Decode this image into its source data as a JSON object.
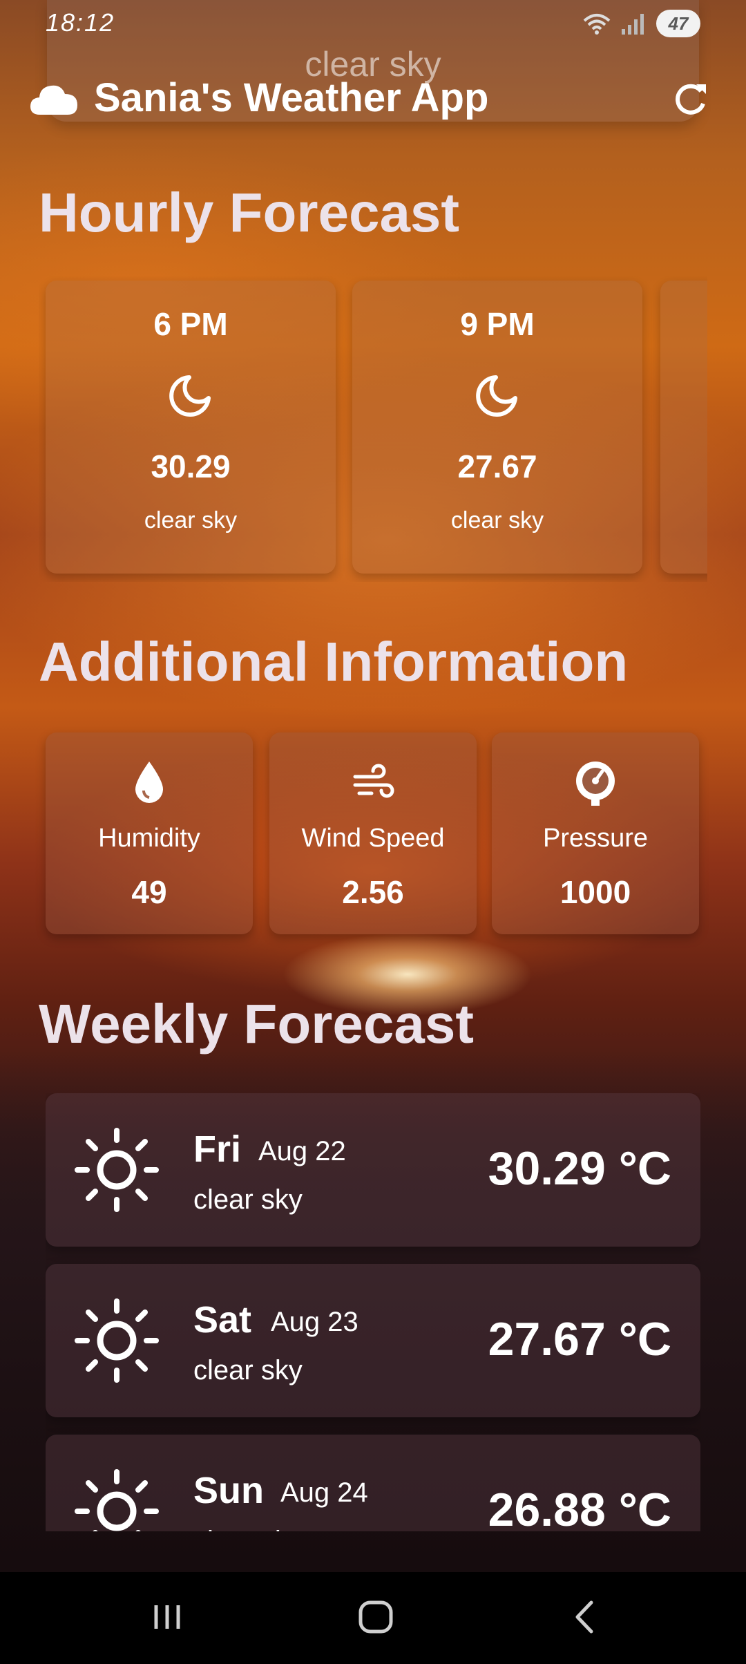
{
  "status_bar": {
    "time": "18:12",
    "battery": "47"
  },
  "header": {
    "ghost_text": "clear sky",
    "title": "Sania's Weather App",
    "icon": "cloud-icon",
    "refresh_icon": "refresh-icon"
  },
  "hourly": {
    "title": "Hourly Forecast",
    "items": [
      {
        "time": "6 PM",
        "icon": "moon-icon",
        "temp": "30.29",
        "desc": "clear sky"
      },
      {
        "time": "9 PM",
        "icon": "moon-icon",
        "temp": "27.67",
        "desc": "clear sky"
      }
    ]
  },
  "additional": {
    "title": "Additional Information",
    "items": [
      {
        "label": "Humidity",
        "value": "49",
        "icon": "water-drop-icon"
      },
      {
        "label": "Wind Speed",
        "value": "2.56",
        "icon": "wind-icon"
      },
      {
        "label": "Pressure",
        "value": "1000",
        "icon": "gauge-icon"
      }
    ]
  },
  "weekly": {
    "title": "Weekly Forecast",
    "items": [
      {
        "day": "Fri",
        "date": "Aug 22",
        "desc": "clear sky",
        "temp": "30.29 °C",
        "icon": "sun-icon"
      },
      {
        "day": "Sat",
        "date": "Aug 23",
        "desc": "clear sky",
        "temp": "27.67 °C",
        "icon": "sun-icon"
      },
      {
        "day": "Sun",
        "date": "Aug 24",
        "desc": "clear sky",
        "temp": "26.88 °C",
        "icon": "sun-icon"
      }
    ]
  },
  "nav": {
    "recents": "recents-icon",
    "home": "home-icon",
    "back": "back-icon"
  }
}
